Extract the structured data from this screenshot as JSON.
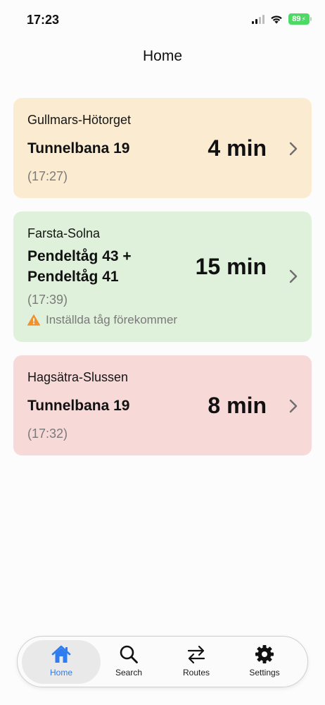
{
  "status_bar": {
    "time": "17:23",
    "battery": "89",
    "icons": [
      "cellular-signal-icon",
      "wifi-icon",
      "battery-charging-icon"
    ]
  },
  "header": {
    "title": "Home"
  },
  "routes": [
    {
      "name": "Gullmars-Hötorget",
      "line": "Tunnelbana 19",
      "duration": "4 min",
      "arrival": "(17:27)",
      "color": "#fbebd1"
    },
    {
      "name": "Farsta-Solna",
      "line_1": "Pendeltåg 43 +",
      "line_2": "Pendeltåg 41",
      "duration": "15 min",
      "arrival": "(17:39)",
      "warning": "Inställda tåg förekommer",
      "color": "#dff0db"
    },
    {
      "name": "Hagsätra-Slussen",
      "line": "Tunnelbana 19",
      "duration": "8 min",
      "arrival": "(17:32)",
      "color": "#f7d9d8"
    }
  ],
  "tab_bar": {
    "active": "Home",
    "accent": "#2f7bf0",
    "tabs": [
      {
        "label": "Home",
        "icon": "house-icon"
      },
      {
        "label": "Search",
        "icon": "magnifier-icon"
      },
      {
        "label": "Routes",
        "icon": "swap-arrows-icon"
      },
      {
        "label": "Settings",
        "icon": "gear-icon"
      }
    ]
  }
}
